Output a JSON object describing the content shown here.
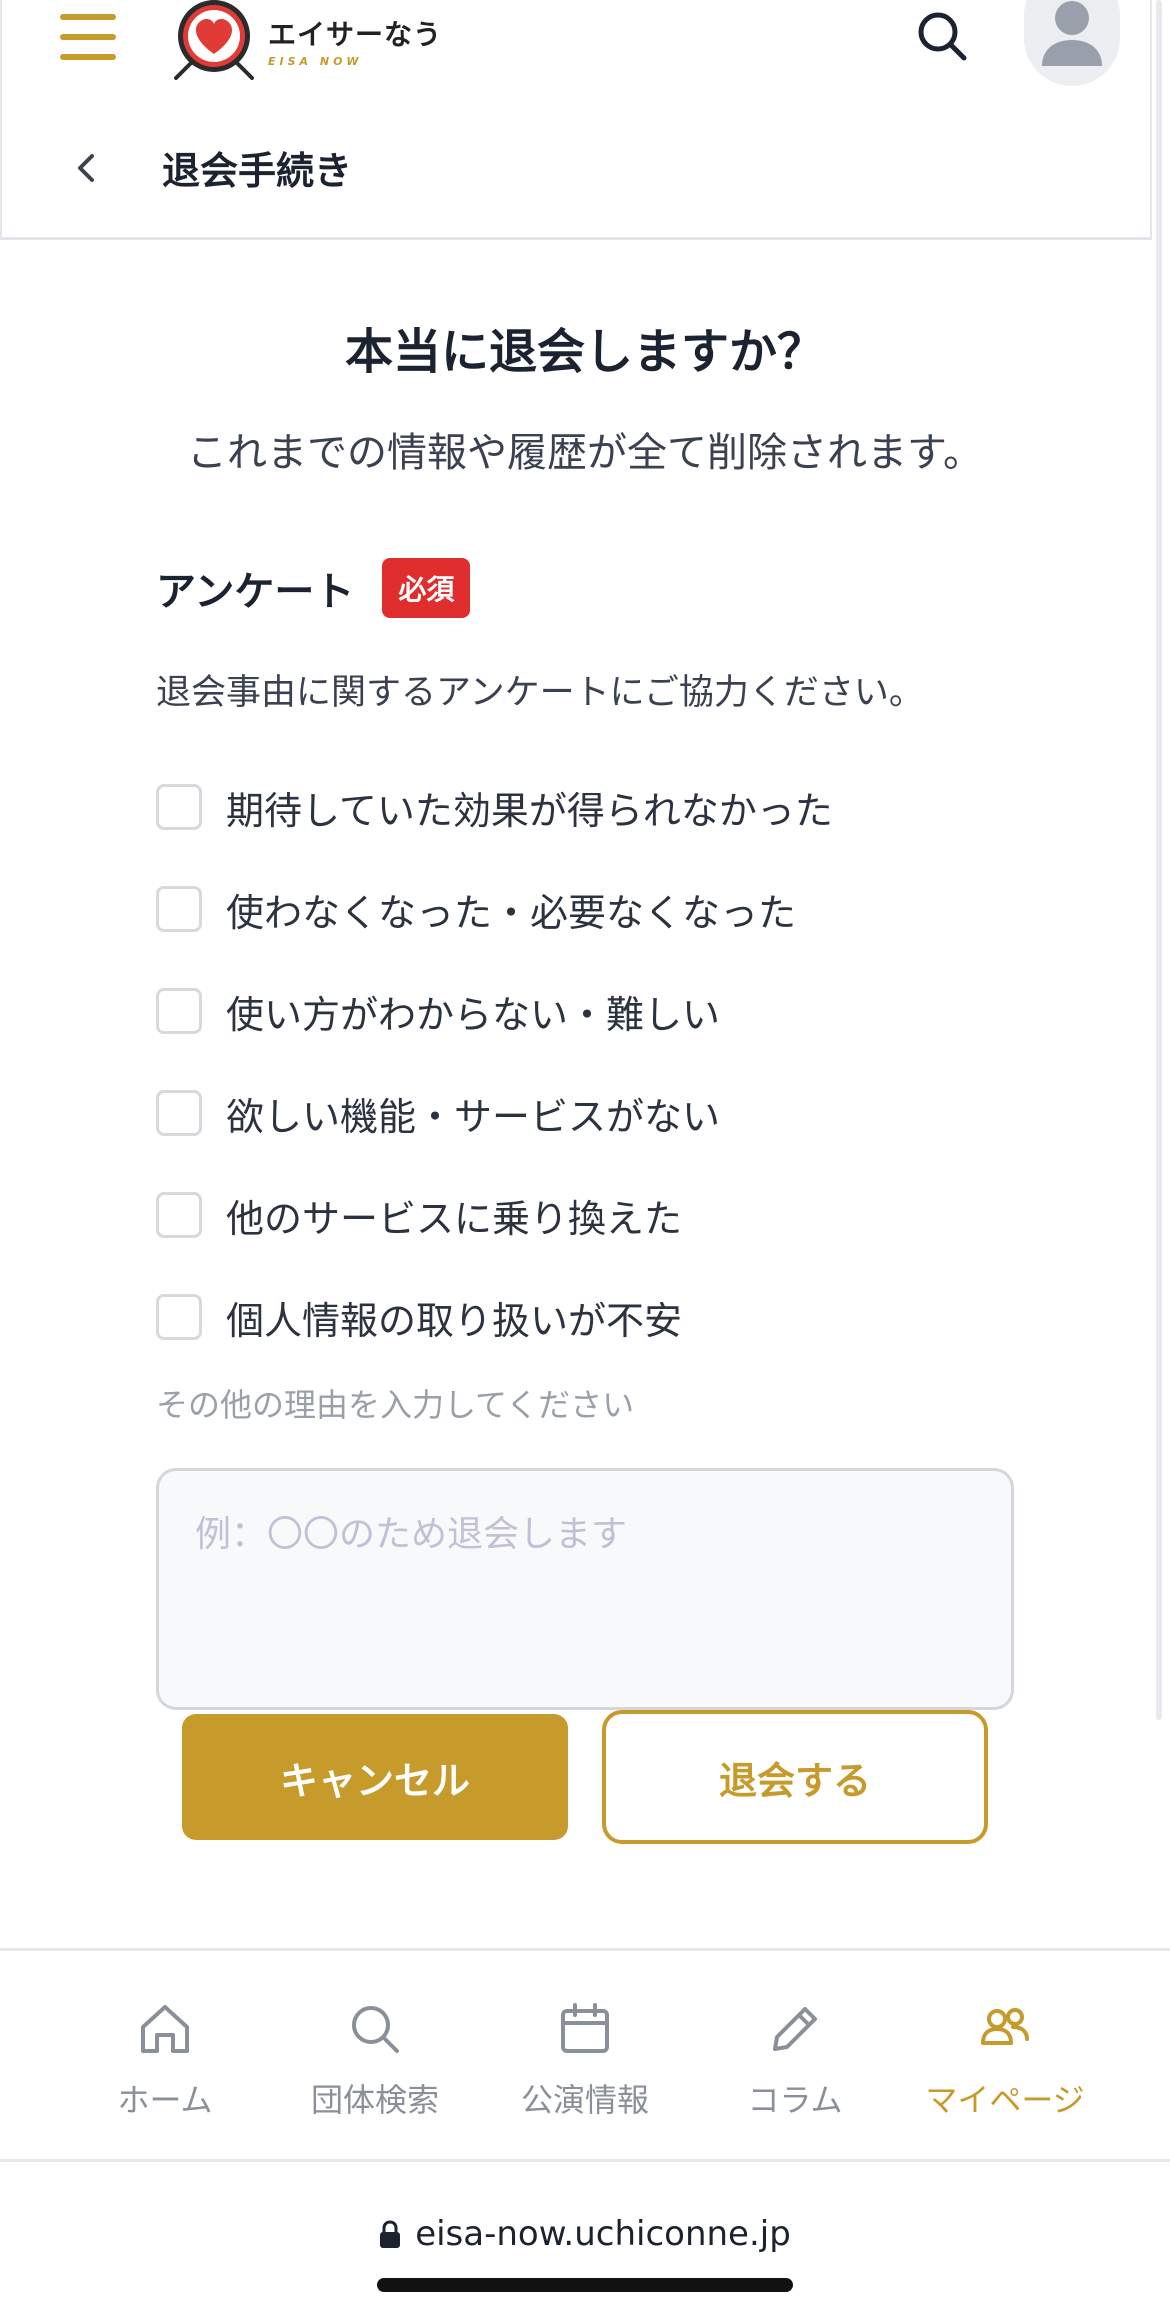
{
  "header": {
    "logo_name": "エイサーなう",
    "logo_sub": "EISA NOW",
    "title": "退会手続き"
  },
  "main": {
    "title": "本当に退会しますか？",
    "subtitle": "これまでの情報や履歴が全て削除されます。"
  },
  "survey": {
    "title": "アンケート",
    "required_badge": "必須",
    "description": "退会事由に関するアンケートにご協力ください。",
    "options": [
      {
        "label": "期待していた効果が得られなかった",
        "checked": false
      },
      {
        "label": "使わなくなった・必要なくなった",
        "checked": false
      },
      {
        "label": "使い方がわからない・難しい",
        "checked": false
      },
      {
        "label": "欲しい機能・サービスがない",
        "checked": false
      },
      {
        "label": "他のサービスに乗り換えた",
        "checked": false
      },
      {
        "label": "個人情報の取り扱いが不安",
        "checked": false
      }
    ],
    "other_label": "その他の理由を入力してください",
    "other_placeholder": "例：〇〇のため退会します",
    "other_value": ""
  },
  "buttons": {
    "cancel": "キャンセル",
    "withdraw": "退会する"
  },
  "nav": {
    "items": [
      {
        "label": "ホーム",
        "icon": "home-icon",
        "active": false
      },
      {
        "label": "団体検索",
        "icon": "search-icon",
        "active": false
      },
      {
        "label": "公演情報",
        "icon": "calendar-icon",
        "active": false
      },
      {
        "label": "コラム",
        "icon": "pencil-icon",
        "active": false
      },
      {
        "label": "マイページ",
        "icon": "users-icon",
        "active": true
      }
    ]
  },
  "browser": {
    "url": "eisa-now.uchiconne.jp"
  },
  "colors": {
    "accent": "#c79a2c",
    "required": "#e02d2d",
    "text": "#1c2330",
    "muted": "#8a909a"
  }
}
